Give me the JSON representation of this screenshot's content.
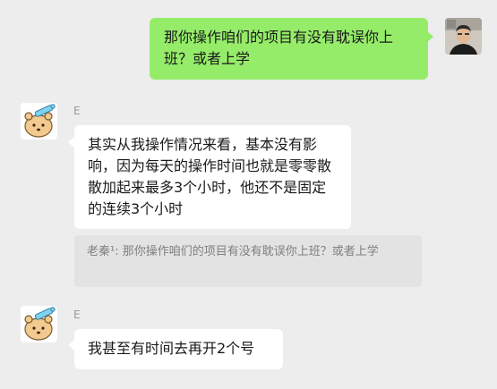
{
  "messages": [
    {
      "direction": "outgoing",
      "text": "那你操作咱们的项目有没有耽误你上班？或者上学"
    },
    {
      "direction": "incoming",
      "sender": "E",
      "text": "其实从我操作情况来看，基本没有影响，因为每天的操作时间也就是零零散散加起来最多3个小时，他还不是固定的连续3个小时"
    },
    {
      "quote": "老秦¹: 那你操作咱们的项目有没有耽误你上班？或者上学"
    },
    {
      "direction": "incoming",
      "sender": "E",
      "text": "我甚至有时间去再开2个号"
    }
  ],
  "colors": {
    "background": "#ededed",
    "outgoing_bubble": "#95ec69",
    "incoming_bubble": "#ffffff",
    "quote_background": "#e3e3e3"
  },
  "icons": {
    "self_avatar": "user-photo-avatar",
    "contact_avatar": "cartoon-bear-avatar"
  }
}
